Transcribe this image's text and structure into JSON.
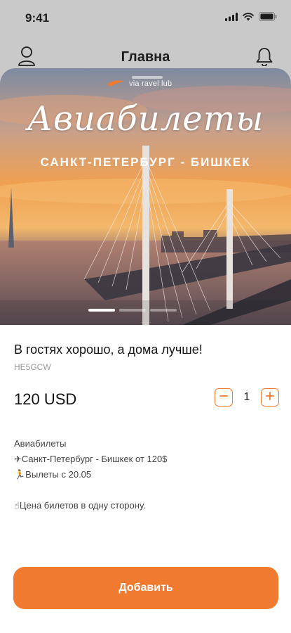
{
  "status_bar": {
    "time": "9:41"
  },
  "nav": {
    "title": "Главна"
  },
  "banner": {
    "logo_text": "via ravel lub",
    "title": "Авиабилеты",
    "route": "САНКТ-ПЕТЕРБУРГ - БИШКЕК",
    "slides_count": 3,
    "active_slide": 1
  },
  "product": {
    "title": "В гостях хорошо, а дома лучше!",
    "code": "HE5GCW",
    "price": "120 USD",
    "quantity": "1",
    "description": [
      "Авиабилеты",
      "✈Санкт-Петербург - Бишкек от 120$",
      "🏃Вылеты с 20.05",
      "",
      "☝Цена билетов в одну сторону."
    ]
  },
  "actions": {
    "add_label": "Добавить"
  },
  "colors": {
    "accent": "#f07a30",
    "header_bg": "#c9c9c9"
  },
  "icons": [
    "signal-icon",
    "wifi-icon",
    "battery-icon",
    "profile-icon",
    "bell-icon",
    "plane-logo-icon",
    "minus-icon",
    "plus-icon"
  ]
}
